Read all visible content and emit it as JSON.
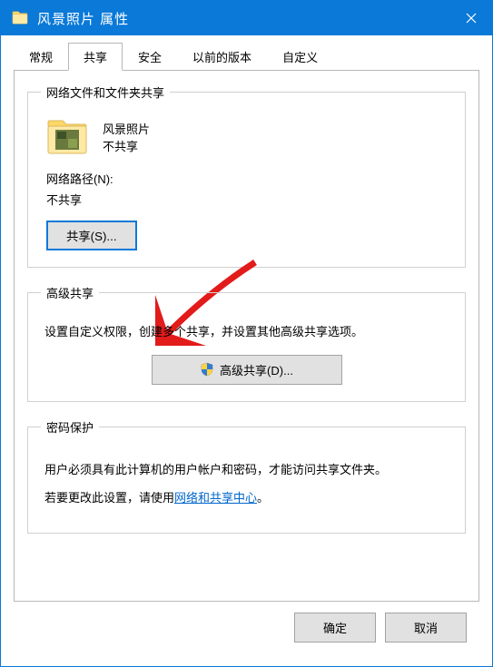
{
  "window": {
    "title": "风景照片 属性"
  },
  "tabs": {
    "general": "常规",
    "share": "共享",
    "security": "安全",
    "previous": "以前的版本",
    "custom": "自定义"
  },
  "groups": {
    "network_sharing": {
      "legend": "网络文件和文件夹共享",
      "folder_name": "风景照片",
      "folder_status": "不共享",
      "path_label": "网络路径(N):",
      "path_value": "不共享",
      "share_button": "共享(S)..."
    },
    "advanced_sharing": {
      "legend": "高级共享",
      "description": "设置自定义权限，创建多个共享，并设置其他高级共享选项。",
      "button": "高级共享(D)..."
    },
    "password_protection": {
      "legend": "密码保护",
      "line1": "用户必须具有此计算机的用户帐户和密码，才能访问共享文件夹。",
      "line2_prefix": "若要更改此设置，请使用",
      "link": "网络和共享中心",
      "line2_suffix": "。"
    }
  },
  "footer": {
    "ok": "确定",
    "cancel": "取消"
  }
}
